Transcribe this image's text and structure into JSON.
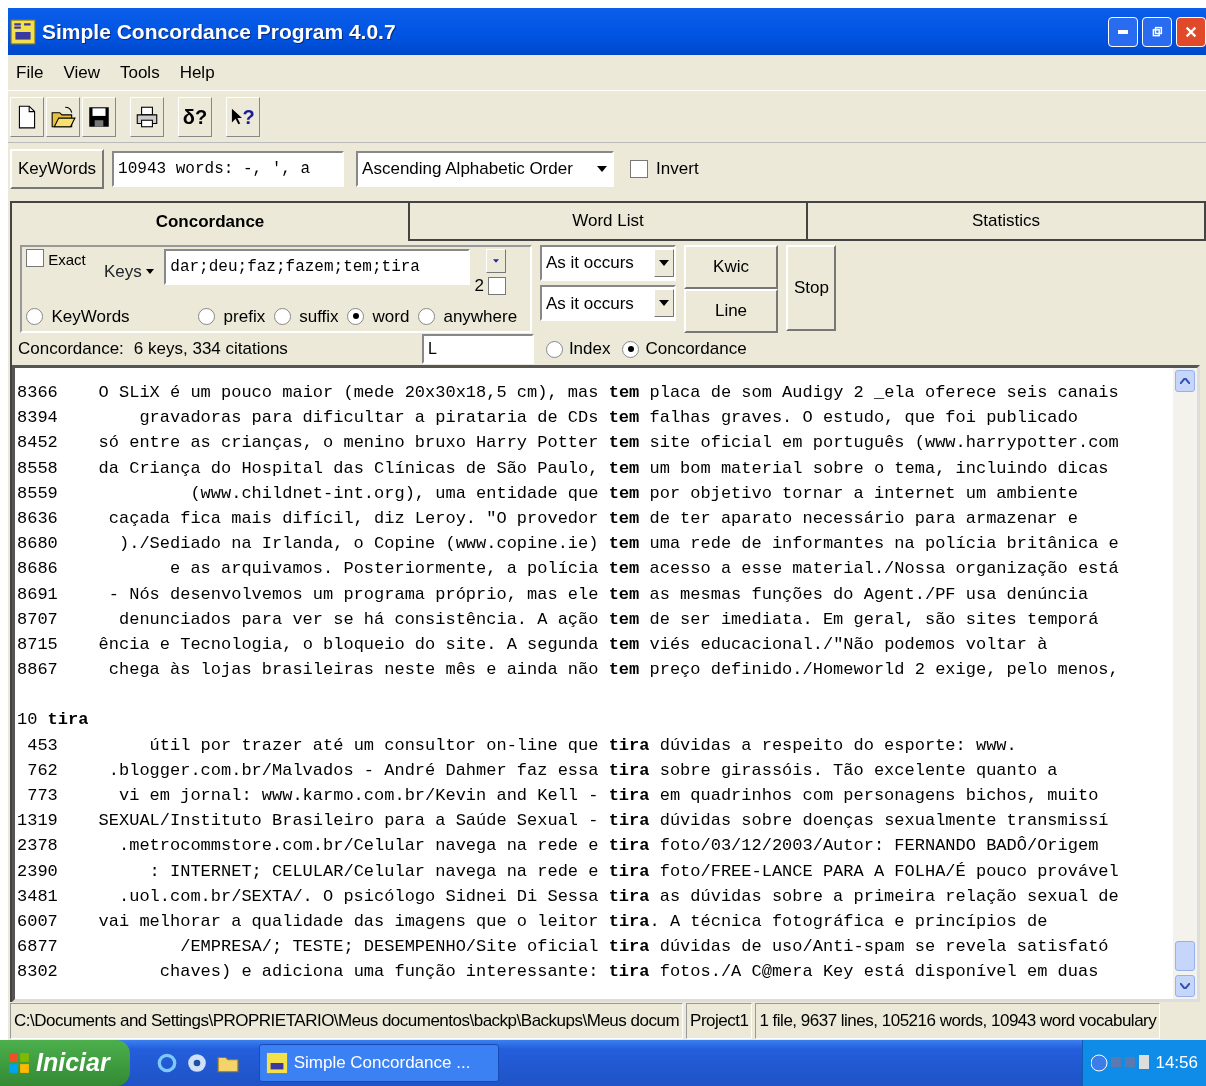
{
  "window": {
    "title": "Simple Concordance Program 4.0.7"
  },
  "menu": [
    "File",
    "View",
    "Tools",
    "Help"
  ],
  "toolbar": [
    {
      "kind": "new"
    },
    {
      "kind": "open"
    },
    {
      "kind": "save"
    },
    {
      "kind": "print"
    },
    {
      "kind": "text",
      "label": "δ?"
    },
    {
      "kind": "pointer-help",
      "label": "?"
    }
  ],
  "keywords_bar": {
    "button": "KeyWords",
    "field_value": "10943 words: -, ', a",
    "sort_order": "Ascending Alphabetic Order",
    "invert": {
      "label": "Invert",
      "checked": false
    }
  },
  "tabs": [
    {
      "label": "Concordance",
      "selected": true
    },
    {
      "label": "Word List",
      "selected": false
    },
    {
      "label": "Statistics",
      "selected": false
    }
  ],
  "search": {
    "exact": {
      "label": "Exact",
      "checked": false
    },
    "keys_menu": "Keys",
    "keys_value": "dar;deu;faz;fazem;tem;tira",
    "context_lines": "2",
    "context_checked": false,
    "match_options": [
      {
        "label": "KeyWords",
        "selected": false
      },
      {
        "label": "prefix",
        "selected": false
      },
      {
        "label": "suffix",
        "selected": false
      },
      {
        "label": "word",
        "selected": true
      },
      {
        "label": "anywhere",
        "selected": false
      }
    ],
    "sort_first": "As it occurs",
    "sort_second": "As it occurs",
    "buttons": [
      "Kwic",
      "Line"
    ],
    "stop_button": "Stop"
  },
  "summary_label": "Concordance:",
  "summary": "6 keys, 334 citations",
  "filter_value": "L",
  "view_options": [
    {
      "label": "Index",
      "selected": false
    },
    {
      "label": "Concordance",
      "selected": true
    }
  ],
  "results": [
    {
      "kind": "line",
      "number": "8366",
      "text": "O SLiX é um pouco maior (mede 20x30x18,5 cm), mas **tem** placa de som Audigy 2 _ela oferece seis canais"
    },
    {
      "kind": "line",
      "number": "8394",
      "text": "gravadoras para dificultar a pirataria de CDs **tem** falhas graves. O estudo, que foi publicado"
    },
    {
      "kind": "line",
      "number": "8452",
      "text": "só entre as crianças, o menino bruxo Harry Potter **tem** site oficial em português (www.harrypotter.com"
    },
    {
      "kind": "line",
      "number": "8558",
      "text": "da Criança do Hospital das Clínicas de São Paulo, **tem** um bom material sobre o tema, incluindo dicas"
    },
    {
      "kind": "line",
      "number": "8559",
      "text": "(www.childnet-int.org), uma entidade que **tem** por objetivo tornar a internet um ambiente"
    },
    {
      "kind": "line",
      "number": "8636",
      "text": "caçada fica mais difícil, diz Leroy. \"O provedor **tem** de ter aparato necessário para armazenar e"
    },
    {
      "kind": "line",
      "number": "8680",
      "text": ")./Sediado na Irlanda, o Copine (www.copine.ie) **tem** uma rede de informantes na polícia britânica e"
    },
    {
      "kind": "line",
      "number": "8686",
      "text": "e as arquivamos. Posteriormente, a polícia **tem** acesso a esse material./Nossa organização está"
    },
    {
      "kind": "line",
      "number": "8691",
      "text": "- Nós desenvolvemos um programa próprio, mas ele **tem** as mesmas funções do Agent./PF usa denúncia"
    },
    {
      "kind": "line",
      "number": "8707",
      "text": "denunciados para ver se há consistência. A ação **tem** de ser imediata. Em geral, são sites temporá"
    },
    {
      "kind": "line",
      "number": "8715",
      "text": "ência e Tecnologia, o bloqueio do site. A segunda **tem** viés educacional./\"Não podemos voltar à"
    },
    {
      "kind": "line",
      "number": "8867",
      "text": "chega às lojas brasileiras neste mês e ainda não **tem** preço definido./Homeworld 2 exige, pelo menos,"
    },
    {
      "kind": "blank"
    },
    {
      "kind": "heading",
      "text": "10 **tira**"
    },
    {
      "kind": "line",
      "number": "453",
      "text": "útil por trazer até um consultor on-line que **tira** dúvidas a respeito do esporte: www."
    },
    {
      "kind": "line",
      "number": "762",
      "text": ".blogger.com.br/Malvados - André Dahmer faz essa **tira** sobre girassóis. Tão excelente quanto a"
    },
    {
      "kind": "line",
      "number": "773",
      "text": "vi em jornal: www.karmo.com.br/Kevin and Kell - **tira** em quadrinhos com personagens bichos, muito"
    },
    {
      "kind": "line",
      "number": "1319",
      "text": "SEXUAL/Instituto Brasileiro para a Saúde Sexual - **tira** dúvidas sobre doenças sexualmente transmissí"
    },
    {
      "kind": "line",
      "number": "2378",
      "text": ".metrocommstore.com.br/Celular navega na rede e **tira** foto/03/12/2003/Autor: FERNANDO BADÔ/Origem"
    },
    {
      "kind": "line",
      "number": "2390",
      "text": ": INTERNET; CELULAR/Celular navega na rede e **tira** foto/FREE-LANCE PARA A FOLHA/É pouco provável"
    },
    {
      "kind": "line",
      "number": "3481",
      "text": ".uol.com.br/SEXTA/. O psicólogo Sidnei Di Sessa **tira** as dúvidas sobre a primeira relação sexual de"
    },
    {
      "kind": "line",
      "number": "6007",
      "text": "vai melhorar a qualidade das imagens que o leitor **tira**. A técnica fotográfica e princípios de"
    },
    {
      "kind": "line",
      "number": "6877",
      "text": "/EMPRESA/; TESTE; DESEMPENHO/Site oficial **tira** dúvidas de uso/Anti-spam se revela satisfató"
    },
    {
      "kind": "line",
      "number": "8302",
      "text": "chaves) e adiciona uma função interessante: **tira** fotos./A C@mera Key está disponível em duas"
    }
  ],
  "status_bar": [
    "C:\\Documents and Settings\\PROPRIETARIO\\Meus documentos\\backp\\Backups\\Meus docum",
    "Project1",
    "1 file, 9637 lines, 105216 words, 10943 word vocabulary"
  ],
  "taskbar": {
    "start": "Iniciar",
    "tasks": [
      {
        "label": "Simple Concordance ..."
      }
    ],
    "clock": "14:56"
  }
}
